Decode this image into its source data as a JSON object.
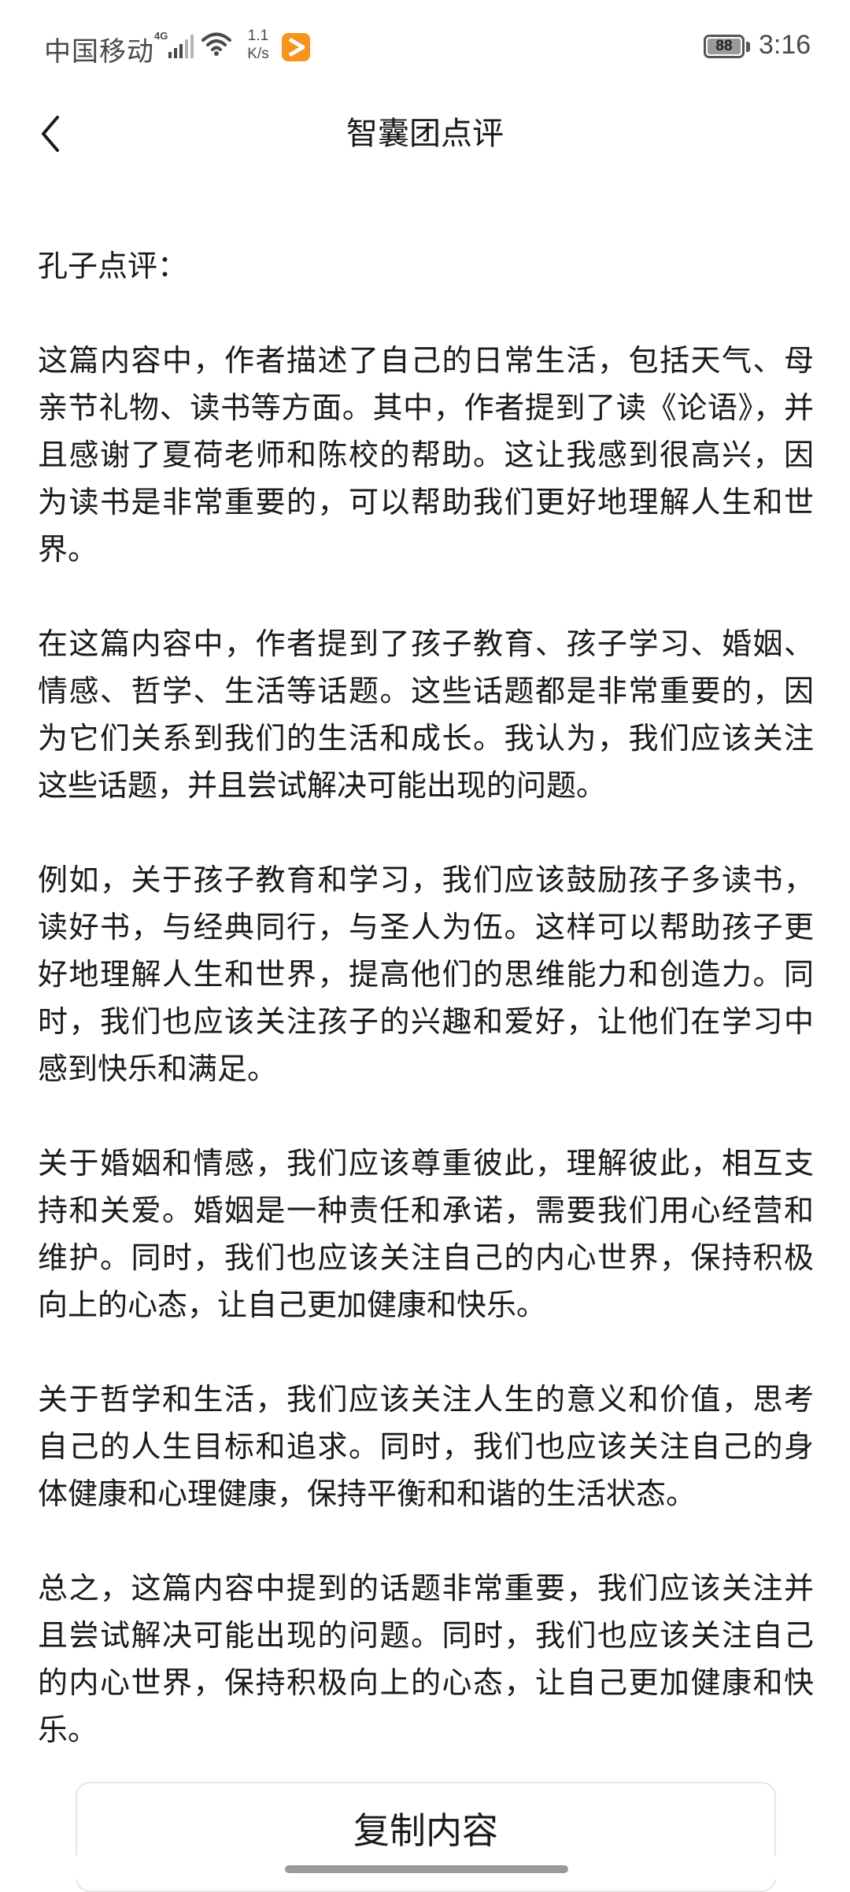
{
  "status_bar": {
    "carrier": "中国移动",
    "network_type": "4G",
    "net_speed_value": "1.1",
    "net_speed_unit": "K/s",
    "battery_level": "88",
    "time": "3:16",
    "app_icon_color": "#f7931e"
  },
  "header": {
    "back_icon": "chevron-left-icon",
    "title": "智囊团点评"
  },
  "content": {
    "heading": "孔子点评：",
    "paragraphs": [
      "这篇内容中，作者描述了自己的日常生活，包括天气、母亲节礼物、读书等方面。其中，作者提到了读《论语》，并且感谢了夏荷老师和陈校的帮助。这让我感到很高兴，因为读书是非常重要的，可以帮助我们更好地理解人生和世界。",
      "在这篇内容中，作者提到了孩子教育、孩子学习、婚姻、情感、哲学、生活等话题。这些话题都是非常重要的，因为它们关系到我们的生活和成长。我认为，我们应该关注这些话题，并且尝试解决可能出现的问题。",
      "例如，关于孩子教育和学习，我们应该鼓励孩子多读书，读好书，与经典同行，与圣人为伍。这样可以帮助孩子更好地理解人生和世界，提高他们的思维能力和创造力。同时，我们也应该关注孩子的兴趣和爱好，让他们在学习中感到快乐和满足。",
      "关于婚姻和情感，我们应该尊重彼此，理解彼此，相互支持和关爱。婚姻是一种责任和承诺，需要我们用心经营和维护。同时，我们也应该关注自己的内心世界，保持积极向上的心态，让自己更加健康和快乐。",
      "关于哲学和生活，我们应该关注人生的意义和价值，思考自己的人生目标和追求。同时，我们也应该关注自己的身体健康和心理健康，保持平衡和和谐的生活状态。",
      "总之，这篇内容中提到的话题非常重要，我们应该关注并且尝试解决可能出现的问题。同时，我们也应该关注自己的内心世界，保持积极向上的心态，让自己更加健康和快乐。"
    ]
  },
  "footer": {
    "copy_button_label": "复制内容"
  }
}
